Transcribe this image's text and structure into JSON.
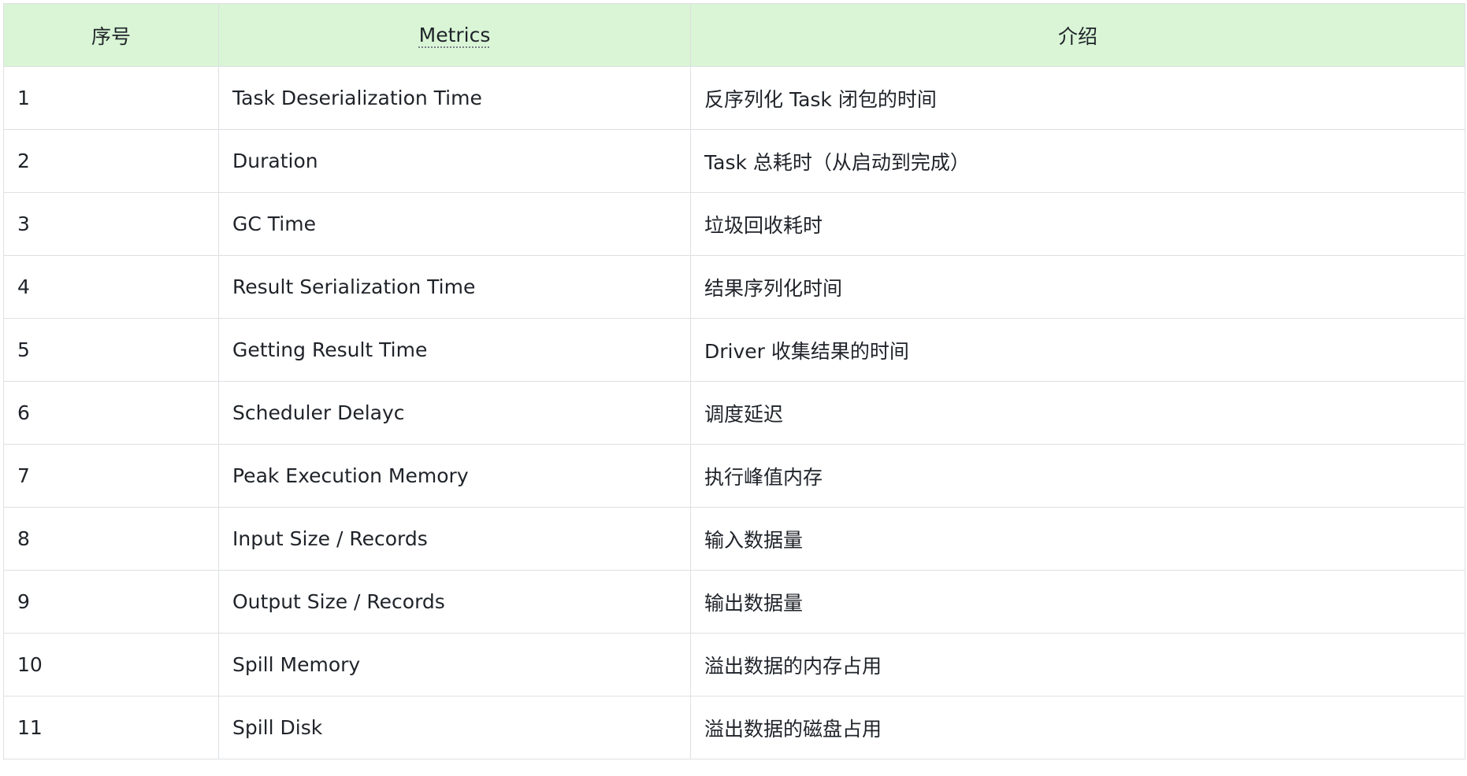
{
  "table": {
    "headers": [
      "序号",
      "Metrics",
      "介绍"
    ],
    "rows": [
      {
        "index": "1",
        "metric": "Task Deserialization Time",
        "description": "反序列化 Task 闭包的时间"
      },
      {
        "index": "2",
        "metric": "Duration",
        "description": "Task 总耗时（从启动到完成）"
      },
      {
        "index": "3",
        "metric": "GC Time",
        "description": "垃圾回收耗时"
      },
      {
        "index": "4",
        "metric": "Result Serialization Time",
        "description": "结果序列化时间"
      },
      {
        "index": "5",
        "metric": "Getting Result Time",
        "description": "Driver 收集结果的时间"
      },
      {
        "index": "6",
        "metric": "Scheduler Delayc",
        "description": "调度延迟"
      },
      {
        "index": "7",
        "metric": "Peak Execution Memory",
        "description": "执行峰值内存"
      },
      {
        "index": "8",
        "metric": "Input Size / Records",
        "description": "输入数据量"
      },
      {
        "index": "9",
        "metric": "Output Size / Records",
        "description": "输出数据量"
      },
      {
        "index": "10",
        "metric": "Spill Memory",
        "description": "溢出数据的内存占用"
      },
      {
        "index": "11",
        "metric": "Spill Disk",
        "description": "溢出数据的磁盘占用"
      }
    ]
  },
  "colors": {
    "header_background": "#d9f5d6",
    "border": "#dee0e3",
    "text": "#1f2329"
  }
}
